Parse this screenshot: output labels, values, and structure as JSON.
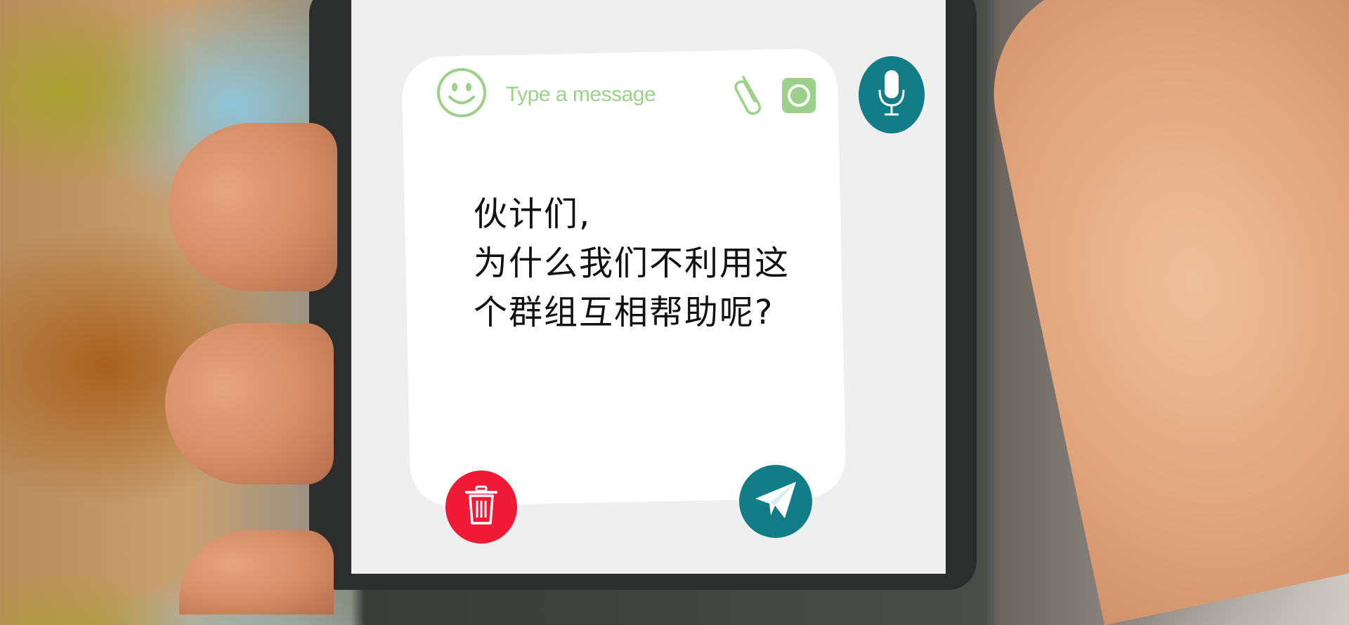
{
  "composer": {
    "placeholder": "Type a message"
  },
  "message": {
    "lines": [
      "伙计们,",
      "为什么我们不利用这",
      "个群组互相帮助呢?"
    ]
  },
  "icons": {
    "emoji": "smiley-icon",
    "attach": "paperclip-icon",
    "camera": "camera-icon",
    "mic": "microphone-icon",
    "delete": "trash-icon",
    "send": "paper-plane-icon"
  },
  "colors": {
    "accent_green": "#9bd18a",
    "teal": "#127d86",
    "delete_red": "#f01a36",
    "card": "#ffffff",
    "screen": "#efefef"
  }
}
